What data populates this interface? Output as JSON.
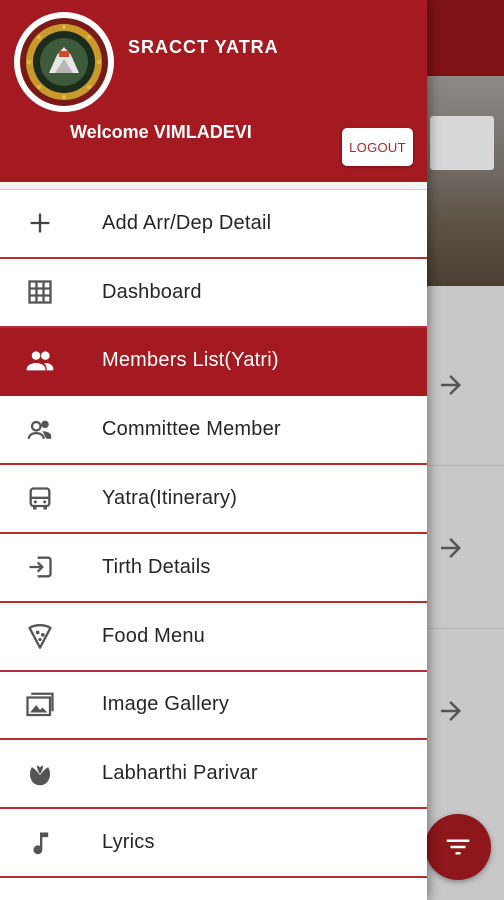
{
  "app": {
    "title": "SRACCT YATRA",
    "welcome": "Welcome VIMLADEVI",
    "logout_label": "LOGOUT"
  },
  "colors": {
    "primary": "#a41a20",
    "divider": "#b32d33",
    "fab": "#8e171b"
  },
  "menu": [
    {
      "label": "Add Arr/Dep Detail",
      "icon": "plus-icon",
      "active": false
    },
    {
      "label": "Dashboard",
      "icon": "grid-icon",
      "active": false
    },
    {
      "label": "Members List(Yatri)",
      "icon": "people-icon",
      "active": true
    },
    {
      "label": "Committee Member",
      "icon": "group-icon",
      "active": false
    },
    {
      "label": "Yatra(Itinerary)",
      "icon": "bus-icon",
      "active": false
    },
    {
      "label": "Tirth Details",
      "icon": "enter-icon",
      "active": false
    },
    {
      "label": "Food Menu",
      "icon": "pizza-icon",
      "active": false
    },
    {
      "label": "Image Gallery",
      "icon": "gallery-icon",
      "active": false
    },
    {
      "label": "Labharthi Parivar",
      "icon": "lotus-icon",
      "active": false
    },
    {
      "label": "Lyrics",
      "icon": "music-note-icon",
      "active": false
    }
  ],
  "background": {
    "fab_icon": "filter-icon",
    "arrow_icon": "arrow-right-icon"
  }
}
